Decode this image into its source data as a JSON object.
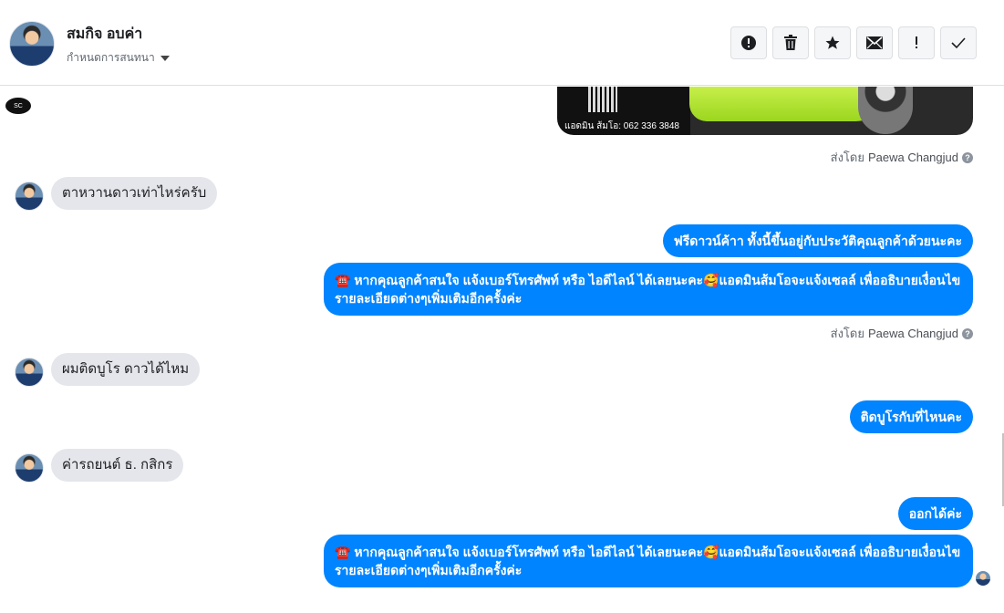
{
  "header": {
    "contact_name": "สมกิจ อบค่า",
    "conversation_settings": "กำหนดการสนทนา",
    "toolbar": [
      {
        "name": "spam-button",
        "icon": "alert-circle-icon"
      },
      {
        "name": "delete-button",
        "icon": "trash-icon"
      },
      {
        "name": "star-button",
        "icon": "star-icon"
      },
      {
        "name": "mark-unread-button",
        "icon": "envelope-icon"
      },
      {
        "name": "important-button",
        "icon": "exclamation-icon"
      },
      {
        "name": "done-button",
        "icon": "check-icon"
      }
    ]
  },
  "thread": {
    "shared_image_caption": "แอดมิน ส้มโอ: 062 336 3848",
    "sent_by_label": "ส่งโดย",
    "agent_name": "Paewa Changjud",
    "messages": {
      "m1": "ตาหวานดาวเท่าไหร่ครับ",
      "m2": "ฟรีดาวน์ค้าา ทั้งนี้ขึ้นอยู่กับประวัติคุณลูกค้าด้วยนะคะ",
      "m3": "☎️ หากคุณลูกค้าสนใจ แจ้งเบอร์โทรศัพท์ หรือ ไอดีไลน์  ได้เลยนะคะ🥰แอดมินส้มโอจะแจ้งเซลล์   เพื่ออธิบายเงื่อนไขรายละเอียดต่างๆเพิ่มเติมอีกครั้งค่ะ",
      "m4": "ผมติดบูโร ดาวได้ไหม",
      "m5": "ติดบูโรกับที่ไหนคะ",
      "m6": "ค่ารถยนต์ ธ. กสิกร",
      "m7": "ออกได้ค่ะ",
      "m8": "☎️ หากคุณลูกค้าสนใจ แจ้งเบอร์โทรศัพท์ หรือ ไอดีไลน์  ได้เลยนะคะ🥰แอดมินส้มโอจะแจ้งเซลล์   เพื่ออธิบายเงื่อนไขรายละเอียดต่างๆเพิ่มเติมอีกครั้งค่ะ"
    }
  },
  "colors": {
    "outgoing_bubble": "#0084ff",
    "incoming_bubble": "#e4e6eb"
  }
}
